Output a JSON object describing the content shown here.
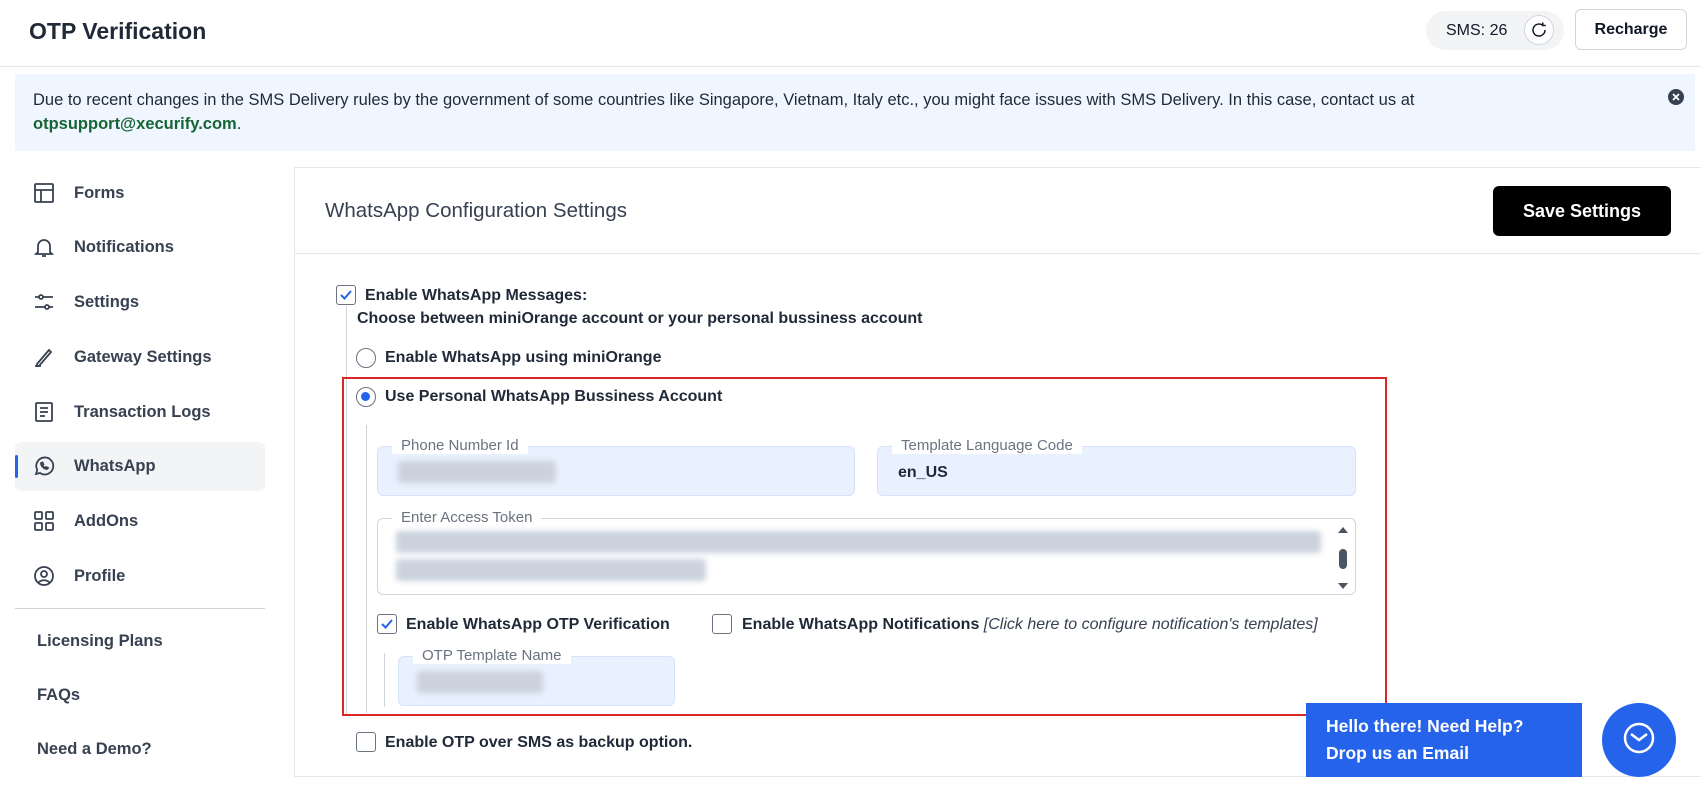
{
  "header": {
    "title": "OTP Verification",
    "sms_label": "SMS: 26",
    "recharge_label": "Recharge"
  },
  "notice": {
    "text": "Due to recent changes in the SMS Delivery rules by the government of some countries like Singapore, Vietnam, Italy etc., you might face issues with SMS Delivery. In this case, contact us at",
    "email": "otpsupport@xecurify.com",
    "suffix": "."
  },
  "sidebar": {
    "items": [
      {
        "label": "Forms",
        "icon": "forms-icon"
      },
      {
        "label": "Notifications",
        "icon": "bell-icon"
      },
      {
        "label": "Settings",
        "icon": "sliders-icon"
      },
      {
        "label": "Gateway Settings",
        "icon": "pen-icon"
      },
      {
        "label": "Transaction Logs",
        "icon": "logs-icon"
      },
      {
        "label": "WhatsApp",
        "icon": "whatsapp-icon",
        "active": true
      },
      {
        "label": "AddOns",
        "icon": "grid-icon"
      },
      {
        "label": "Profile",
        "icon": "user-circle-icon"
      }
    ],
    "links": [
      "Licensing Plans",
      "FAQs",
      "Need a Demo?"
    ]
  },
  "panel": {
    "title": "WhatsApp Configuration Settings",
    "save_label": "Save Settings",
    "enable_whatsapp_label": "Enable WhatsApp Messages:",
    "choose_text": "Choose between miniOrange account or your personal bussiness account",
    "option_miniorange": "Enable WhatsApp using miniOrange",
    "option_personal": "Use Personal WhatsApp Bussiness Account",
    "phone_number_label": "Phone Number Id",
    "template_lang_label": "Template Language Code",
    "template_lang_value": "en_US",
    "access_token_label": "Enter Access Token",
    "otp_verification_label": "Enable WhatsApp OTP Verification",
    "notifications_label": "Enable WhatsApp Notifications",
    "notifications_note": "[Click here to configure notification's templates]",
    "otp_template_label": "OTP Template Name",
    "sms_backup_label": "Enable OTP over SMS as backup option."
  },
  "help": {
    "line1": "Hello there! Need Help?",
    "line2": "Drop us an Email"
  },
  "colors": {
    "accent": "#2563eb",
    "highlight": "#dc2626",
    "email": "#166534"
  }
}
